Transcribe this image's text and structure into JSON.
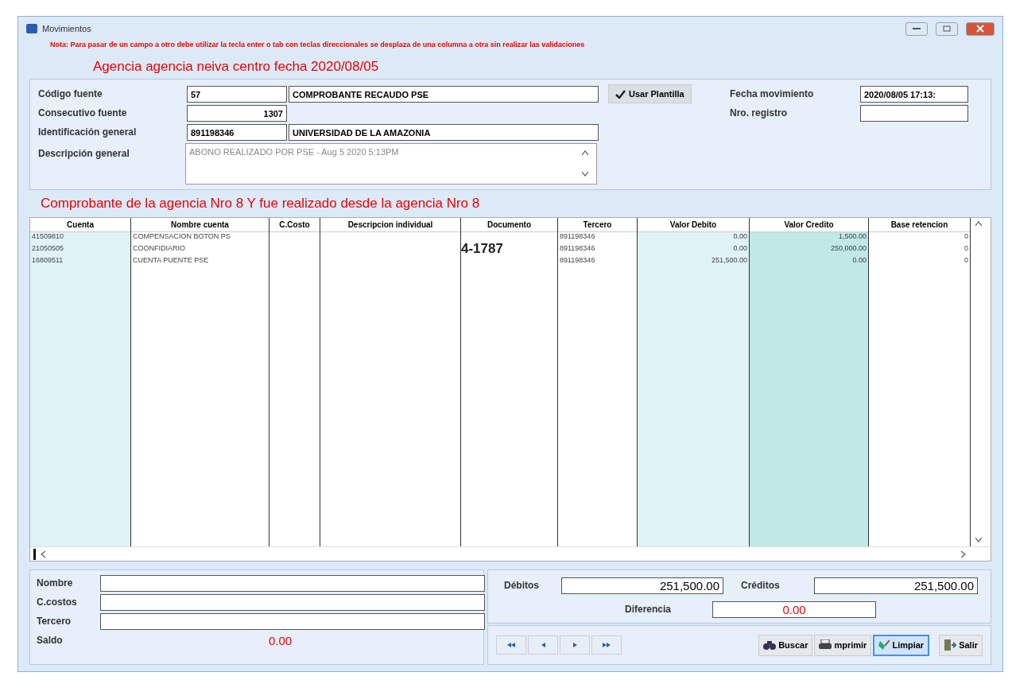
{
  "window": {
    "title": "Movimientos"
  },
  "note": "Nota: Para pasar de un campo a otro debe utilizar la tecla enter o tab  con teclas direccionales se desplaza de una columna  a otra sin realizar las validaciones",
  "agency": "Agencia agencia neiva centro fecha 2020/08/05",
  "header": {
    "codigo_fuente": {
      "label": "Código fuente",
      "code": "57",
      "name": "COMPROBANTE RECAUDO PSE"
    },
    "template_button": {
      "label": "Usar Plantilla",
      "checked": true
    },
    "consecutivo": {
      "label": "Consecutivo fuente",
      "value": "1307"
    },
    "identificacion": {
      "label": "Identificación general",
      "code": "891198346",
      "name": "UNIVERSIDAD  DE LA AMAZONIA"
    },
    "descripcion": {
      "label": "Descripción general",
      "value": "ABONO REALIZADO POR PSE - Aug  5 2020  5:13PM"
    },
    "fecha": {
      "label": "Fecha movimiento",
      "value": "2020/08/05 17:13:"
    },
    "registro": {
      "label": "Nro. registro"
    }
  },
  "grid_title": "Comprobante de la agencia Nro 8 Y fue realizado desde la agencia Nro 8",
  "table": {
    "columns": [
      "Cuenta",
      "Nombre cuenta",
      "C.Costo",
      "Descripcion individual",
      "Documento",
      "Tercero",
      "Valor Debito",
      "Valor Credito",
      "Base retencion"
    ],
    "rows": [
      {
        "cuenta": "41509810",
        "nombre": "COMPENSACION BOTON PS",
        "tercero": "891198346",
        "debito": "0.00",
        "credito": "1,500.00",
        "base": "0"
      },
      {
        "cuenta": "21050505",
        "nombre": "COONFIDIARIO",
        "documento": "4-1787",
        "tercero": "891198346",
        "debito": "0.00",
        "credito": "250,000.00",
        "base": "0"
      },
      {
        "cuenta": "16809511",
        "nombre": "CUENTA PUENTE PSE",
        "tercero": "891198346",
        "debito": "251,500.00",
        "credito": "0.00",
        "base": "0"
      }
    ]
  },
  "footer": {
    "fields": [
      {
        "label": "Nombre"
      },
      {
        "label": "C.costos"
      },
      {
        "label": "Tercero"
      }
    ],
    "saldo": {
      "label": "Saldo",
      "value": "0.00"
    },
    "debitos": {
      "label": "Débitos",
      "value": "251,500.00"
    },
    "creditos": {
      "label": "Créditos",
      "value": "251,500.00"
    },
    "diferencia": {
      "label": "Diferencia",
      "value": "0.00"
    },
    "buttons": [
      {
        "kind": "buscar",
        "label": "Buscar",
        "focused": false
      },
      {
        "kind": "imprimir",
        "label": "mprimir",
        "focused": false
      },
      {
        "kind": "limpiar",
        "label": "Limpiar",
        "focused": true
      },
      {
        "kind": "salir",
        "label": "Salir",
        "focused": false
      }
    ]
  }
}
